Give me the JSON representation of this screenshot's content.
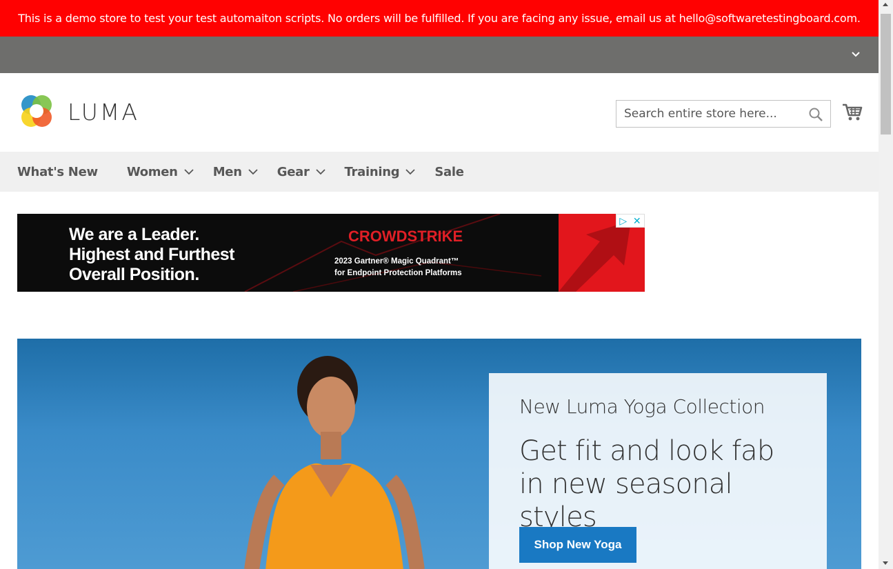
{
  "notice": {
    "text": "This is a demo store to test your test automaiton scripts. No orders will be fulfilled. If you are facing any issue, email us at hello@softwaretestingboard.com."
  },
  "header": {
    "logo_text": "LUMA",
    "search": {
      "placeholder": "Search entire store here...",
      "value": ""
    }
  },
  "nav": {
    "items": [
      {
        "label": "What's New",
        "has_submenu": false
      },
      {
        "label": "Women",
        "has_submenu": true
      },
      {
        "label": "Men",
        "has_submenu": true
      },
      {
        "label": "Gear",
        "has_submenu": true
      },
      {
        "label": "Training",
        "has_submenu": true
      },
      {
        "label": "Sale",
        "has_submenu": false
      }
    ]
  },
  "ad": {
    "line1": "We are a Leader.",
    "line2": "Highest and Furthest",
    "line3": "Overall Position.",
    "brand": "CROWDSTRIKE",
    "sub1": "2023 Gartner® Magic Quadrant™",
    "sub2": "for Endpoint Protection Platforms"
  },
  "hero": {
    "subtitle": "New Luma Yoga Collection",
    "title": "Get fit and look fab in new seasonal styles",
    "button_label": "Shop New Yoga"
  },
  "colors": {
    "notice_bg": "#ff0101",
    "panel_bg": "#6e6e6c",
    "nav_bg": "#f0f0f0",
    "button_blue": "#1979c3"
  },
  "icons": [
    "chevron-down-icon",
    "search-icon",
    "cart-icon",
    "luma-logo-icon",
    "adchoices-icon",
    "close-icon"
  ]
}
